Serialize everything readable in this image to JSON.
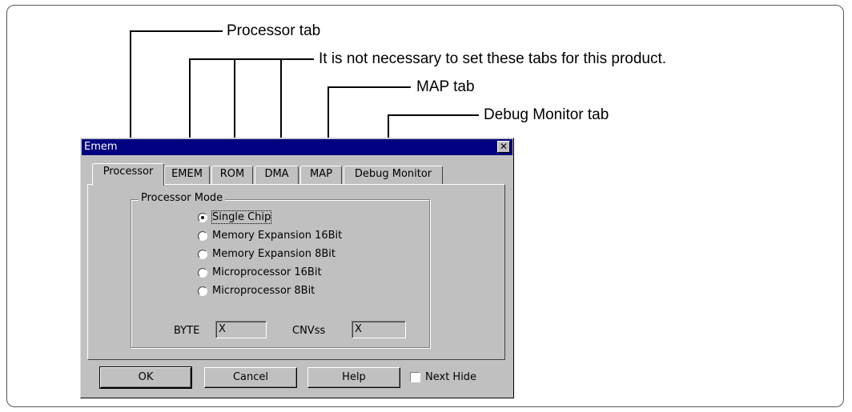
{
  "callouts": {
    "processor_tab": "Processor tab",
    "not_necessary": "It is not necessary to set these tabs for this product.",
    "map_tab": "MAP tab",
    "debug_monitor_tab": "Debug Monitor tab"
  },
  "dialog": {
    "title": "Emem",
    "close_glyph": "✕",
    "tabs": [
      {
        "label": "Processor",
        "active": true
      },
      {
        "label": "EMEM"
      },
      {
        "label": "ROM"
      },
      {
        "label": "DMA"
      },
      {
        "label": "MAP"
      },
      {
        "label": "Debug Monitor"
      }
    ],
    "group_title": "Processor Mode",
    "radios": [
      {
        "label": "Single Chip",
        "selected": true
      },
      {
        "label": "Memory Expansion 16Bit"
      },
      {
        "label": "Memory Expansion 8Bit"
      },
      {
        "label": "Microprocessor 16Bit"
      },
      {
        "label": "Microprocessor 8Bit"
      }
    ],
    "byte_label": "BYTE",
    "byte_value": "X",
    "cnvss_label": "CNVss",
    "cnvss_value": "X",
    "buttons": {
      "ok": "OK",
      "cancel": "Cancel",
      "help": "Help"
    },
    "next_hide_label": "Next Hide",
    "next_hide_checked": false
  }
}
